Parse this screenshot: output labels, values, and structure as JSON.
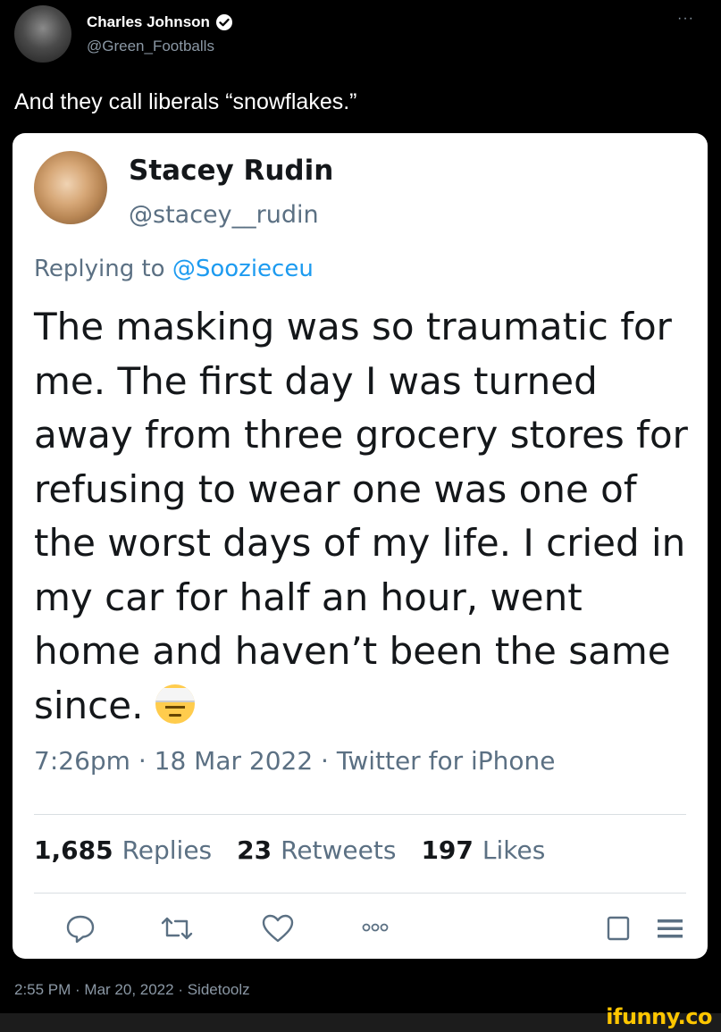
{
  "outer_tweet": {
    "author_name": "Charles Johnson",
    "author_handle": "@Green_Footballs",
    "more_label": "···",
    "text": "And they call liberals “snowflakes.”",
    "timestamp": "2:55 PM · Mar 20, 2022 · Sidetoolz"
  },
  "embedded_tweet": {
    "author_name": "Stacey Rudin",
    "author_handle": "@stacey__rudin",
    "replying_prefix": "Replying to ",
    "replying_mention": "@Soozieceu",
    "body": "The masking was so traumatic for me. The first day I was turned away from three grocery stores for refusing to wear one was one of the worst days of my life. I cried in my car for half an hour, went home and haven’t been the same since.",
    "emoji_icon": "face-with-head-bandage-icon",
    "timestamp": "7:26pm · 18 Mar 2022 · Twitter for iPhone",
    "stats": {
      "replies_count": "1,685",
      "replies_label": "Replies",
      "retweets_count": "23",
      "retweets_label": "Retweets",
      "likes_count": "197",
      "likes_label": "Likes"
    },
    "actions": [
      "reply-icon",
      "retweet-icon",
      "like-icon",
      "more-icon",
      "square-icon",
      "menu-icon"
    ]
  },
  "watermark": "ifunny.co",
  "colors": {
    "background": "#000000",
    "card": "#ffffff",
    "link_blue": "#1d9bf0",
    "secondary_text": "#5b7083",
    "watermark_yellow": "#ffc600"
  }
}
